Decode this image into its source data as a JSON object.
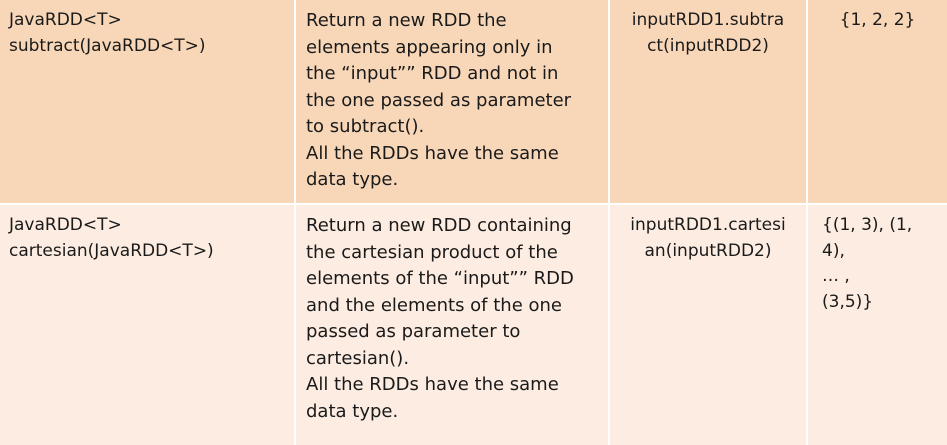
{
  "rows": [
    {
      "method": "JavaRDD<T>\nsubtract(JavaRDD<T>)",
      "description": "Return a new RDD the\nelements appearing only in\nthe “input”” RDD and not in\nthe one passed as parameter\nto subtract().\nAll the RDDs have the same\ndata type.",
      "example": "inputRDD1.subtra\nct(inputRDD2)",
      "result": "{1, 2, 2}"
    },
    {
      "method": "JavaRDD<T>\ncartesian(JavaRDD<T>)",
      "description": "Return a new RDD containing\nthe cartesian product of the\nelements of the “input”” RDD\nand the elements of the one\npassed as parameter to\ncartesian().\nAll the RDDs have the same\ndata type.",
      "example": "inputRDD1.cartesi\nan(inputRDD2)",
      "result": "{(1, 3), (1,\n4),\n… ,\n(3,5)}"
    }
  ],
  "colors": {
    "row_odd": "#f8d7b8",
    "row_even": "#fcece1",
    "grid_line": "#ffffff",
    "text": "#1a1a1a"
  }
}
